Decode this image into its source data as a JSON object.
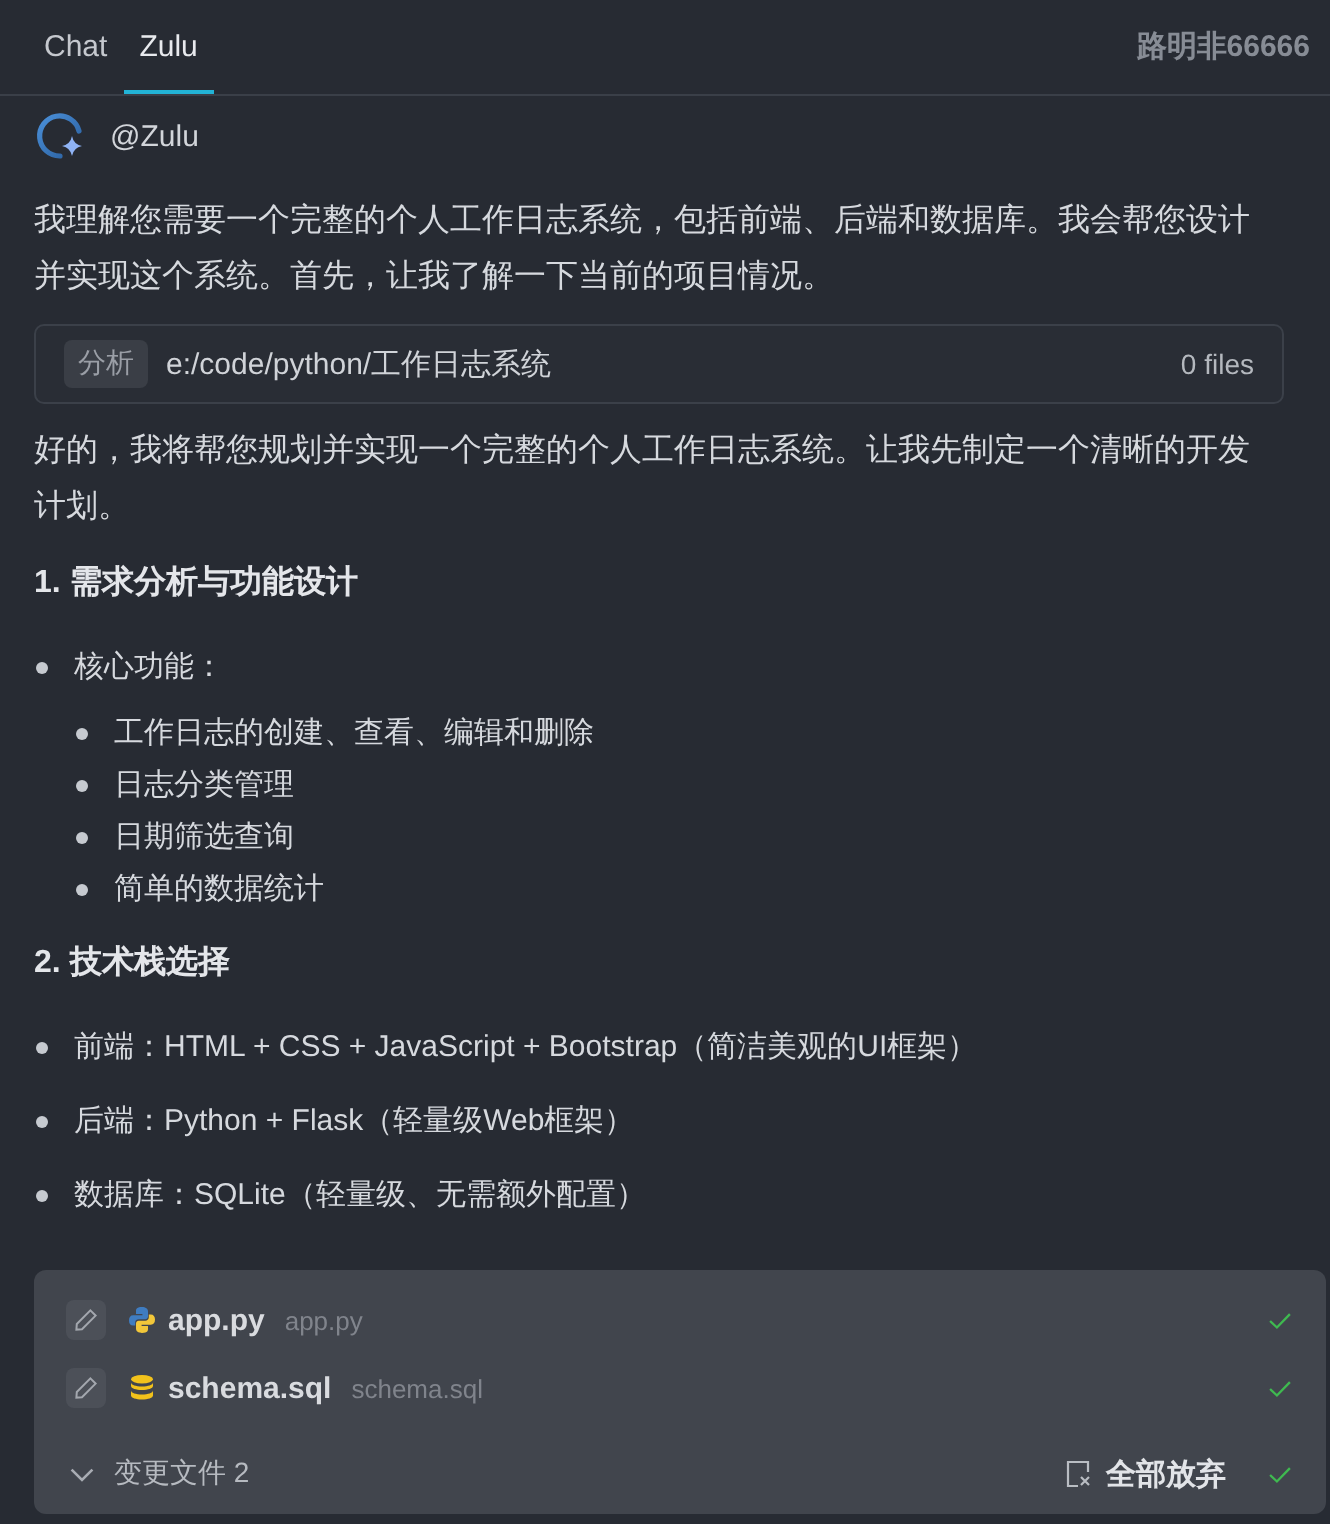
{
  "tabs": [
    {
      "label": "Chat",
      "selected": false
    },
    {
      "label": "Zulu",
      "selected": true
    }
  ],
  "user": {
    "name": "路明非66666"
  },
  "agent": {
    "name": "@Zulu"
  },
  "messages": [
    {
      "kind": "paragraph",
      "text": "我理解您需要一个完整的个人工作日志系统，包括前端、后端和数据库。我会帮您设计并实现这个系统。首先，让我了解一下当前的项目情况。"
    },
    {
      "kind": "context",
      "tag": "分析",
      "path": "e:/code/python/工作日志系统",
      "count": "0 files"
    },
    {
      "kind": "paragraph",
      "text": "好的，我将帮您规划并实现一个完整的个人工作日志系统。让我先制定一个清晰的开发计划。"
    },
    {
      "kind": "heading",
      "text": "1. 需求分析与功能设计"
    },
    {
      "kind": "list",
      "items": [
        {
          "text": "核心功能：",
          "children": [
            {
              "text": "工作日志的创建、查看、编辑和删除"
            },
            {
              "text": "日志分类管理"
            },
            {
              "text": "日期筛选查询"
            },
            {
              "text": "简单的数据统计"
            }
          ]
        }
      ]
    },
    {
      "kind": "heading",
      "text": "2. 技术栈选择"
    },
    {
      "kind": "list",
      "items": [
        {
          "text": "前端：HTML + CSS + JavaScript + Bootstrap（简洁美观的UI框架）"
        },
        {
          "text": "后端：Python + Flask（轻量级Web框架）"
        },
        {
          "text": "数据库：SQLite（轻量级、无需额外配置）"
        }
      ]
    }
  ],
  "changes": {
    "files": [
      {
        "name": "app.py",
        "path": "app.py",
        "kind": "python",
        "accepted": true
      },
      {
        "name": "schema.sql",
        "path": "schema.sql",
        "kind": "sql",
        "accepted": true
      }
    ],
    "summary": "变更文件 2",
    "discard_label": "全部放弃",
    "accepted": true
  }
}
